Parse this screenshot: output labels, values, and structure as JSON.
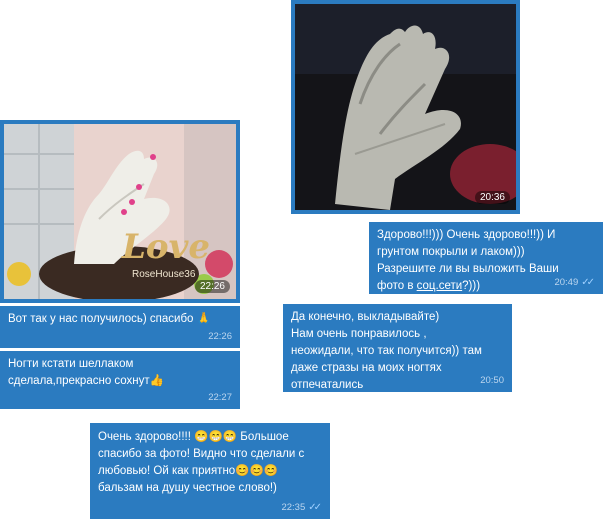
{
  "theme": {
    "bubble": "#2b7bc0",
    "meta_text": "#bcd6ef",
    "read_ticks": "#9fd0ff"
  },
  "photos": [
    {
      "id": "photo-hands-top",
      "time": "20:36"
    },
    {
      "id": "photo-hands-love",
      "time": "22:26",
      "watermark": "Love",
      "watermark_small": "RoseHouse36"
    }
  ],
  "messages": {
    "m1": {
      "text_pre": "Здорово!!!))) Очень здорово!!!)) И грунтом покрыли и  лаком)))\nРазрешите ли вы выложить Ваши\nфото в ",
      "link": "соц.сети",
      "text_post": "?)))",
      "time": "20:49",
      "read": "✓✓"
    },
    "m2": {
      "text": "Вот так у нас получилось) спасибо",
      "emoji": "🙏",
      "time": "22:26"
    },
    "m3": {
      "text": "Да конечно, выкладывайте)\nНам очень понравилось ,\nнеожидали, что так получится)) там\nдаже стразы на моих ногтях\nотпечатались",
      "time": "20:50"
    },
    "m4": {
      "text": "Ногти кстати шеллаком\nсделала,прекрасно сохнут",
      "emoji": "👍",
      "time": "22:27"
    },
    "m5": {
      "text_a": "Очень здорово!!!! ",
      "emo_a": "😁😁😁",
      "text_b": " Большое спасибо за фото! Видно что сделали с любовью! Ой как приятно",
      "emo_b": "😊😊😊",
      "text_c": "\nбальзам на душу честное слово!)",
      "time": "22:35",
      "read": "✓✓"
    }
  }
}
